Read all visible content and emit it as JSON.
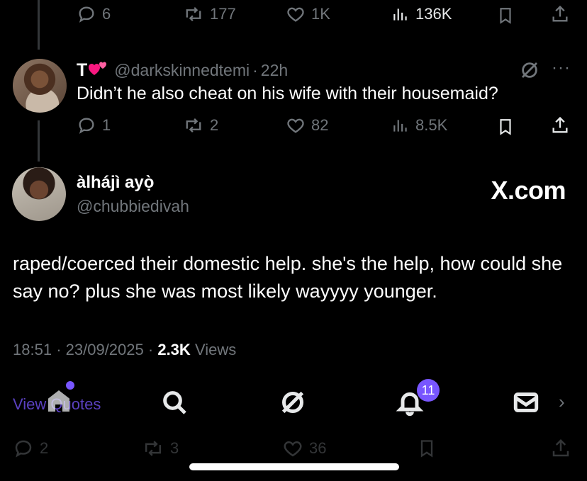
{
  "top_actions": {
    "replies": "6",
    "reposts": "177",
    "likes": "1K",
    "views": "136K"
  },
  "reply_tweet": {
    "display_name": "T",
    "handle": "@darkskinnedtemi",
    "time": "22h",
    "separator": "·",
    "text": "Didn’t he also cheat on his wife with their housemaid?",
    "more": "···",
    "replies": "1",
    "reposts": "2",
    "likes": "82",
    "views": "8.5K"
  },
  "main_tweet": {
    "display_name": "àlhájì ayọ̀",
    "handle": "@chubbiedivah",
    "text": "raped/coerced their domestic help. she's the help, how could she say no? plus she was most likely wayyyy younger.",
    "time": "18:51",
    "date": "23/09/2025",
    "views_count": "2.3K",
    "views_label": "Views",
    "separator": "·"
  },
  "watermark": "X.com",
  "overlay": {
    "view_quotes": "View Quotes",
    "notifications_badge": "11",
    "replies": "2",
    "reposts": "3",
    "likes": "36"
  },
  "colors": {
    "accent": "#7856ff",
    "background": "#000000",
    "muted": "#71767b",
    "heart": "#f91880"
  },
  "icons": [
    "reply-icon",
    "repost-icon",
    "like-icon",
    "views-icon",
    "bookmark-icon",
    "share-icon",
    "grok-icon",
    "more-icon",
    "home-icon",
    "search-icon",
    "notifications-icon",
    "messages-icon"
  ]
}
